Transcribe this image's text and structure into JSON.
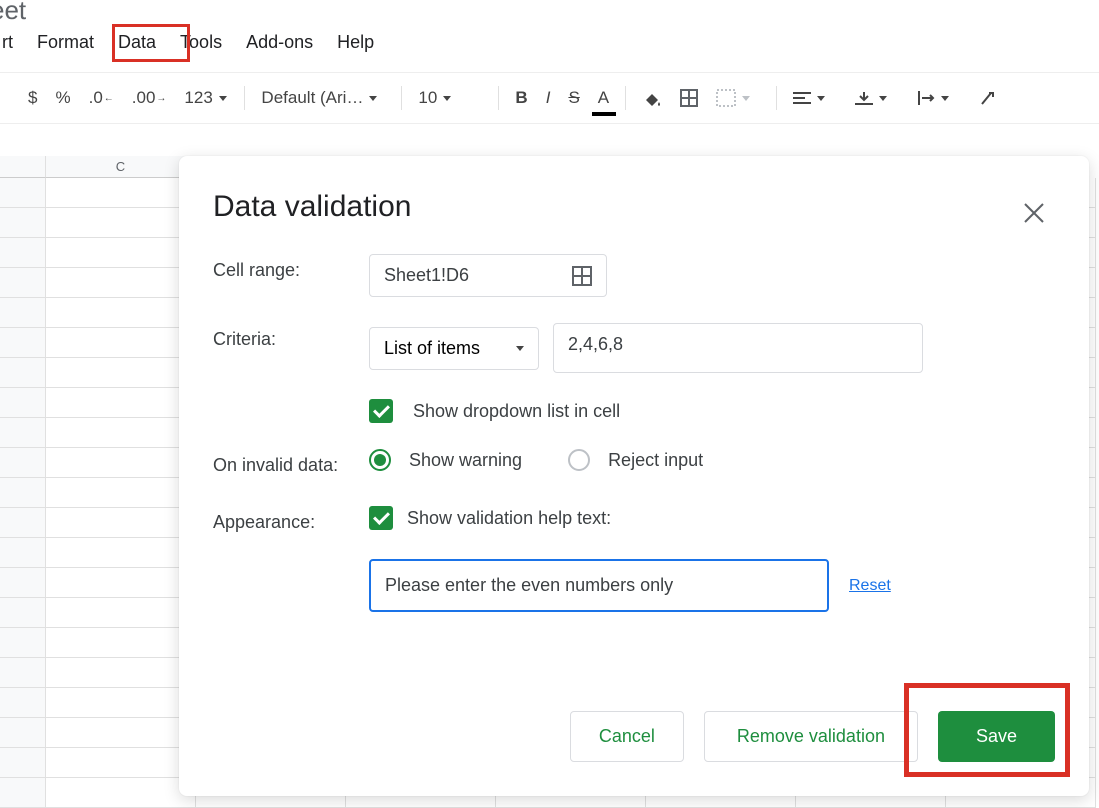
{
  "doc_title": "eet",
  "menu": {
    "insert": "rt",
    "format": "Format",
    "data": "Data",
    "tools": "Tools",
    "addons": "Add-ons",
    "help": "Help"
  },
  "toolbar": {
    "currency": "$",
    "percent": "%",
    "dec_less": ".0",
    "dec_more": ".00",
    "number_format": "123",
    "font": "Default (Ari…",
    "size": "10",
    "bold": "B",
    "italic": "I",
    "strike": "S",
    "text_color": "A"
  },
  "sheet": {
    "col_c": "C"
  },
  "dialog": {
    "title": "Data validation",
    "labels": {
      "cell_range": "Cell range:",
      "criteria": "Criteria:",
      "on_invalid": "On invalid data:",
      "appearance": "Appearance:"
    },
    "cell_range_value": "Sheet1!D6",
    "criteria_type": "List of items",
    "criteria_value": "2,4,6,8",
    "show_dropdown": "Show dropdown list in cell",
    "show_warning": "Show warning",
    "reject_input": "Reject input",
    "show_help_text": "Show validation help text:",
    "help_text_value": "Please enter the even numbers only",
    "reset": "Reset",
    "buttons": {
      "cancel": "Cancel",
      "remove": "Remove validation",
      "save": "Save"
    }
  }
}
